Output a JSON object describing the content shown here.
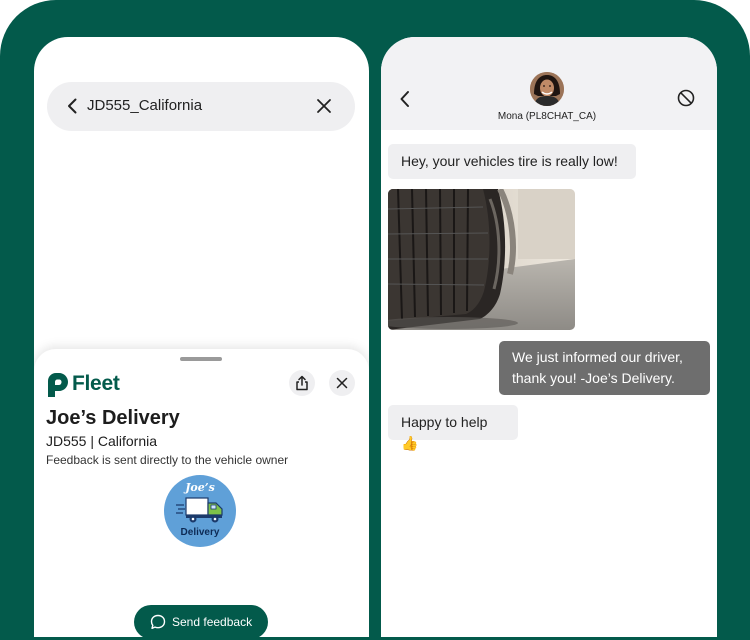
{
  "colors": {
    "brand_green": "#035a4b",
    "bubble_incoming": "#efeff1",
    "bubble_outgoing": "#6e6e6e",
    "badge_blue": "#5fa0d8"
  },
  "search": {
    "query": "JD555_California",
    "back_icon": "chevron-left-icon",
    "clear_icon": "close-icon"
  },
  "sheet": {
    "logo_text": "Fleet",
    "share_icon": "share-icon",
    "close_icon": "close-icon",
    "business_name": "Joe’s Delivery",
    "plate_info": "JD555 | California",
    "note": "Feedback is sent directly to the vehicle owner",
    "badge_top": "Joe’s",
    "badge_bottom": "Delivery",
    "feedback_button": "Send feedback",
    "feedback_icon": "chat-bubble-icon"
  },
  "chat": {
    "contact_name": "Mona (PL8CHAT_CA)",
    "back_icon": "chevron-left-icon",
    "block_icon": "block-icon",
    "messages": [
      {
        "direction": "incoming",
        "text": "Hey, your vehicles tire is really low!"
      },
      {
        "direction": "incoming",
        "type": "image",
        "alt": "flat tire photo"
      },
      {
        "direction": "outgoing",
        "text": "We just informed our driver, thank you!  -Joe’s Delivery."
      },
      {
        "direction": "incoming",
        "text": "Happy to help 👍"
      }
    ]
  }
}
